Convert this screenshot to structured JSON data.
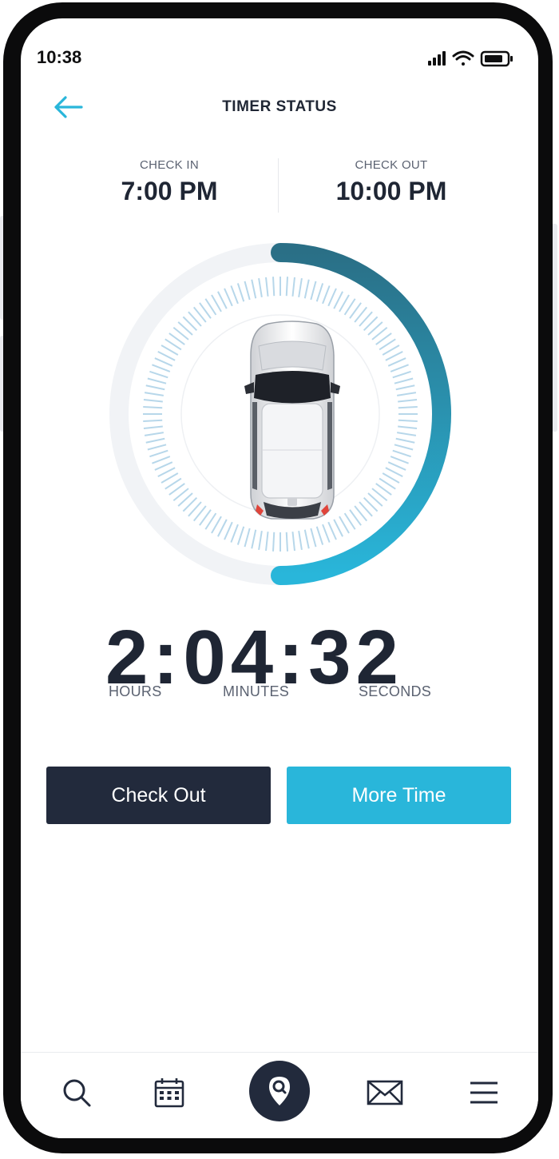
{
  "status_bar": {
    "time": "10:38"
  },
  "header": {
    "title": "TIMER STATUS"
  },
  "schedule": {
    "check_in_label": "CHECK IN",
    "check_in_value": "7:00 PM",
    "check_out_label": "CHECK OUT",
    "check_out_value": "10:00 PM"
  },
  "timer": {
    "display": "2:04:32",
    "hours_label": "HOURS",
    "minutes_label": "MINUTES",
    "seconds_label": "SECONDS",
    "progress_fraction": 0.5
  },
  "actions": {
    "check_out_label": "Check Out",
    "more_time_label": "More Time"
  },
  "tab_bar": {
    "items": [
      "search-icon",
      "calendar-icon",
      "location-search-icon",
      "mail-icon",
      "menu-icon"
    ],
    "active": "location-search-icon"
  },
  "colors": {
    "accent": "#29b6da",
    "dark": "#222a3c",
    "text": "#1f2634",
    "ring_start": "#2a6f86",
    "ring_end": "#29b6da"
  }
}
